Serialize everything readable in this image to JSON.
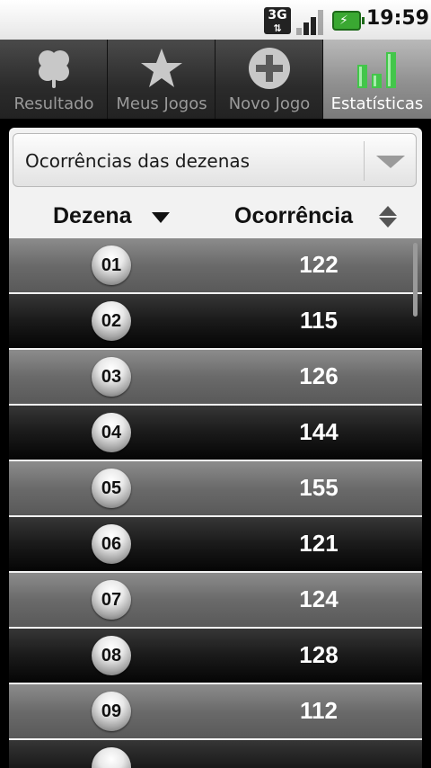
{
  "status_bar": {
    "network": "3G",
    "time": "19:59"
  },
  "tabs": [
    {
      "label": "Resultado",
      "icon": "clover-icon",
      "active": false
    },
    {
      "label": "Meus Jogos",
      "icon": "star-icon",
      "active": false
    },
    {
      "label": "Novo Jogo",
      "icon": "plus-circle-icon",
      "active": false
    },
    {
      "label": "Estatísticas",
      "icon": "bar-chart-icon",
      "active": true
    }
  ],
  "spinner": {
    "selected": "Ocorrências das dezenas"
  },
  "table": {
    "columns": [
      "Dezena",
      "Ocorrência"
    ],
    "rows": [
      {
        "dezena": "01",
        "ocorrencia": "122"
      },
      {
        "dezena": "02",
        "ocorrencia": "115"
      },
      {
        "dezena": "03",
        "ocorrencia": "126"
      },
      {
        "dezena": "04",
        "ocorrencia": "144"
      },
      {
        "dezena": "05",
        "ocorrencia": "155"
      },
      {
        "dezena": "06",
        "ocorrencia": "121"
      },
      {
        "dezena": "07",
        "ocorrencia": "124"
      },
      {
        "dezena": "08",
        "ocorrencia": "128"
      },
      {
        "dezena": "09",
        "ocorrencia": "112"
      }
    ]
  },
  "colors": {
    "active_icon": "#43c64a",
    "inactive_icon": "#c8c8c8"
  }
}
